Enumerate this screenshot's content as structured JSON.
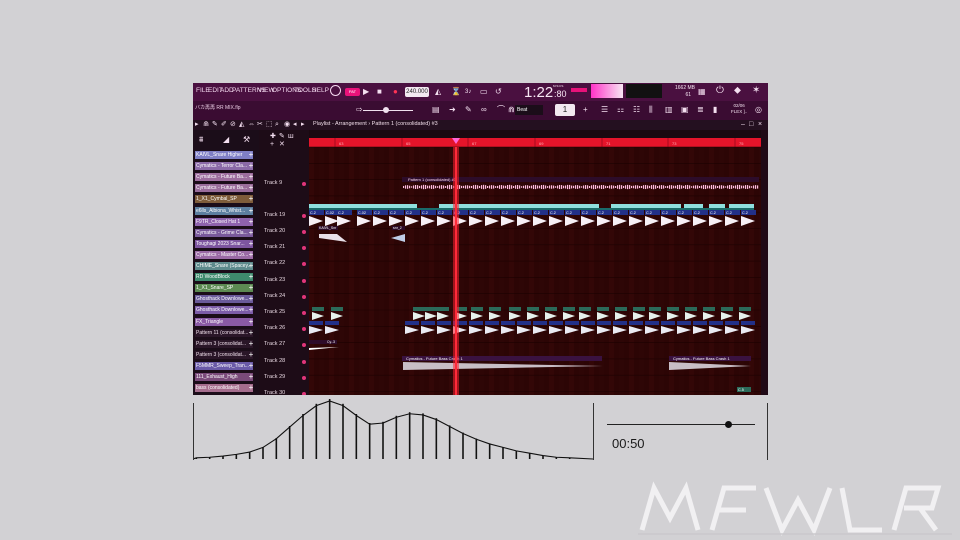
{
  "menu": [
    "FILE",
    "EDIT",
    "ADD",
    "PATTERNS",
    "VIEW",
    "OPTIONS",
    "TOOLS",
    "HELP"
  ],
  "project_name": "バカ再再 RR MIX.flp",
  "transport": {
    "tempo": "240.000",
    "time": "1:22",
    "time_small": ":80",
    "time_label": "M:S:CS"
  },
  "status": {
    "memory": "1662 MB",
    "cpu": "61"
  },
  "version_badge": "02/06\nFLEX ]..",
  "snap_label": "Beat",
  "playlist_title": "Playlist - Arrangement › Pattern 1 (consolidated) #3",
  "ruler_marks": [
    "63",
    "65",
    "67",
    "69",
    "71",
    "73",
    "75"
  ],
  "instruments": [
    {
      "name": "KAIVL_Snare Higher",
      "color": "#7f7fc6"
    },
    {
      "name": "Cymatics - Terror Cla...",
      "color": "#8b6aa8"
    },
    {
      "name": "Cymatics - Future Ba...",
      "color": "#9d6d9e"
    },
    {
      "name": "Cymatics - Future Ba...",
      "color": "#9a6d9b"
    },
    {
      "name": "1_X1_Cymbal_SP",
      "color": "#7e5c3a"
    },
    {
      "name": "e6lls_Albiona_Whist...",
      "color": "#5c7fa0"
    },
    {
      "name": "F9TR_Closed Hat 1",
      "color": "#8e62ad"
    },
    {
      "name": "Cymatics - Grime Cla...",
      "color": "#7a5a9c"
    },
    {
      "name": "Toughagi 2023 Snar...",
      "color": "#7d55a0"
    },
    {
      "name": "Cymatics - Master Co...",
      "color": "#9a6aa5"
    },
    {
      "name": "CHIME_Snare (Spacey...",
      "color": "#5d8a8c"
    },
    {
      "name": "RD WoodBlock",
      "color": "#3e8a6d"
    },
    {
      "name": "1_X1_Snare_SP",
      "color": "#5c8a52"
    },
    {
      "name": "Ghosthack Downlowe...",
      "color": "#6a5a9a"
    },
    {
      "name": "Ghosthack Downlowe...",
      "color": "#7c5ca8"
    },
    {
      "name": "FX_Triangle",
      "color": "#8a5aa5"
    },
    {
      "name": "Pattern 11 (consolidat...",
      "color": "#2a1628"
    },
    {
      "name": "Pattern 3 (consolidat...",
      "color": "#2a1628"
    },
    {
      "name": "Pattern 3 (consolidat...",
      "color": "#2a1628"
    },
    {
      "name": "F5MMR_Sweep_Tran...",
      "color": "#6a5aa8"
    },
    {
      "name": "111_Exhaust_High",
      "color": "#7a4a7a"
    },
    {
      "name": "bass (consolidated)",
      "color": "#a56d8d"
    }
  ],
  "tracks": [
    "Track 9",
    "Track 19",
    "Track 20",
    "Track 21",
    "Track 22",
    "Track 23",
    "Track 24",
    "Track 25",
    "Track 26",
    "Track 27",
    "Track 28",
    "Track 29",
    "Track 30"
  ],
  "clips": {
    "pattern_long": "Pattern 1 (consolidated) #3",
    "c2": "C.2",
    "c02": "C.02",
    "kaivl": "KAIVL_Snr",
    "snr2": "snr_2",
    "cy3": "Cy..3",
    "crash1": "Cymatics - Future Bass Crash 1",
    "crash2": "Cymatics - Future Bass Crash 1",
    "c5": "C.5"
  },
  "player": {
    "time": "00:50",
    "progress": 0.82
  },
  "waveform_heights": [
    0.02,
    0.03,
    0.05,
    0.08,
    0.12,
    0.2,
    0.35,
    0.55,
    0.75,
    0.92,
    1.0,
    0.92,
    0.75,
    0.6,
    0.62,
    0.72,
    0.78,
    0.76,
    0.68,
    0.56,
    0.44,
    0.34,
    0.26,
    0.2,
    0.14,
    0.1,
    0.06,
    0.03,
    0.02
  ]
}
